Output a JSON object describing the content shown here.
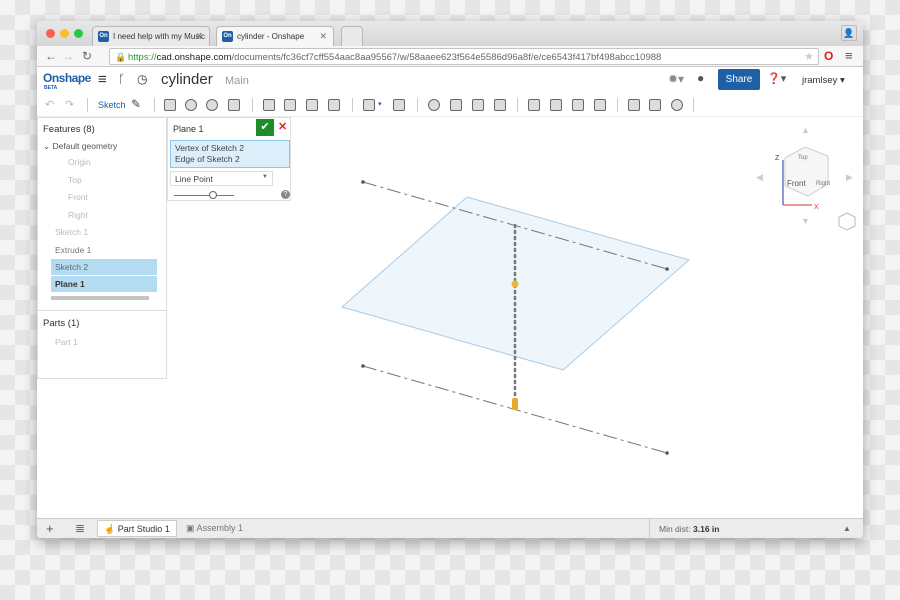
{
  "browser": {
    "tabs": [
      {
        "label": "I need help with my Music",
        "favicon": "On"
      },
      {
        "label": "cylinder - Onshape",
        "favicon": "On"
      }
    ],
    "url": {
      "scheme": "https://",
      "host": "cad.onshape.com",
      "path": "/documents/fc36cf7cff554aac8aa95567/w/58aaee623f564e5586d96a8f/e/ce6543f417bf498abcc10988"
    }
  },
  "app": {
    "logo": "Onshape",
    "logo_sub": "BETA",
    "doc_title": "cylinder",
    "branch": "Main",
    "share_label": "Share",
    "user": "jramlsey",
    "accent": "#1f5fa6"
  },
  "toolbar": {
    "sketch_label": "Sketch"
  },
  "features": {
    "title": "Features (8)",
    "group": "Default geometry",
    "items": [
      "Origin",
      "Top",
      "Front",
      "Right",
      "Sketch 1",
      "Extrude 1",
      "Sketch 2",
      "Plane 1"
    ]
  },
  "parts": {
    "title": "Parts (1)",
    "items": [
      "Part 1"
    ]
  },
  "dialog": {
    "title": "Plane 1",
    "selections": [
      "Vertex of Sketch 2",
      "Edge of Sketch 2"
    ],
    "type": "Line Point",
    "help": "?",
    "slider_value": 0.6
  },
  "viewcube": {
    "top": "Top",
    "front": "Front",
    "right": "Right",
    "axes": [
      "Z",
      "X"
    ]
  },
  "bottom": {
    "tabs": [
      "Part Studio 1",
      "Assembly 1"
    ],
    "min_dist_label": "Min dist:",
    "min_dist_value": "3.16 in"
  }
}
